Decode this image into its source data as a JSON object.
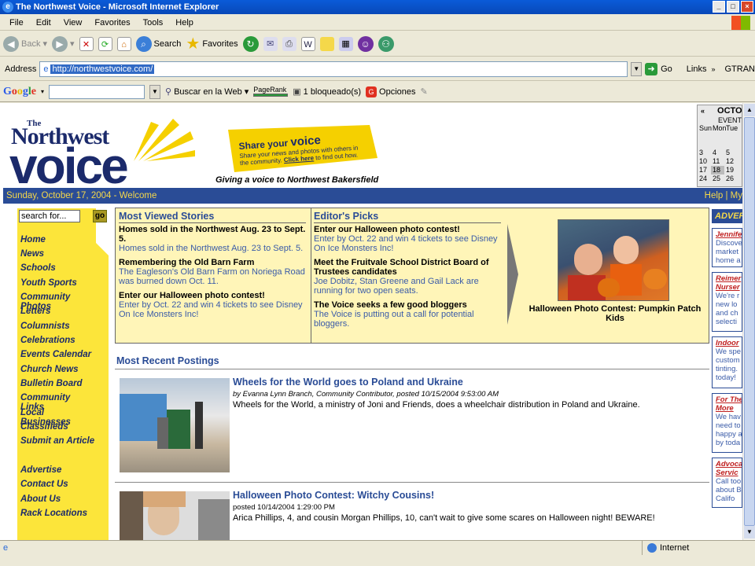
{
  "window": {
    "title": "The Northwest Voice - Microsoft Internet Explorer"
  },
  "menu": [
    "File",
    "Edit",
    "View",
    "Favorites",
    "Tools",
    "Help"
  ],
  "toolbar": {
    "back": "Back",
    "search": "Search",
    "favorites": "Favorites"
  },
  "address": {
    "label": "Address",
    "url": "http://northwestvoice.com/",
    "go": "Go",
    "links": "Links",
    "gtran": "GTRAN"
  },
  "google_bar": {
    "logo": "Google",
    "search_web": "Buscar en la Web",
    "pagerank": "PageRank",
    "blocked": "1 bloqueado(s)",
    "options": "Opciones"
  },
  "header": {
    "logo_the": "The",
    "logo_northwest": "Northwest",
    "logo_voice": "voice",
    "banner_share": "Share your",
    "banner_voice": "voice",
    "banner_line1": "Share your news and photos with others in",
    "banner_line2": "the community.",
    "banner_click": "Click here",
    "banner_line3": "to find out how.",
    "tagline": "Giving a voice to Northwest Bakersfield"
  },
  "calendar": {
    "month": "OCTO",
    "sub": "EVENT",
    "days": [
      "Sun",
      "Mon",
      "Tue"
    ],
    "weeks": [
      [
        "",
        "",
        ""
      ],
      [
        "3",
        "4",
        "5"
      ],
      [
        "10",
        "11",
        "12"
      ],
      [
        "17",
        "18",
        "19"
      ],
      [
        "24",
        "25",
        "26"
      ]
    ]
  },
  "navbar": {
    "date": "Sunday, October 17, 2004",
    "sep": " - ",
    "welcome": "Welcome",
    "right": "Help | My"
  },
  "leftnav": {
    "search_placeholder": "search for...",
    "go": "go",
    "items": [
      "Home",
      "News",
      "Schools",
      "Youth Sports",
      "Community Photos",
      "Letters",
      "Columnists",
      "Celebrations",
      "Events Calendar",
      "Church News",
      "Bulletin Board",
      "Community Links",
      "Local Businesses",
      "Classifieds",
      "Submit an Article"
    ],
    "items2": [
      "Advertise",
      "Contact Us",
      "About Us",
      "Rack Locations"
    ]
  },
  "most_viewed": {
    "heading": "Most Viewed Stories",
    "stories": [
      {
        "title": "Homes sold in the Northwest Aug. 23 to Sept. 5.",
        "desc": "Homes sold in the Northwest Aug. 23 to Sept. 5."
      },
      {
        "title": "Remembering the Old Barn Farm",
        "desc": "The Eagleson's Old Barn Farm on Noriega Road was burned down Oct. 11."
      },
      {
        "title": "Enter our Halloween photo contest!",
        "desc": "Enter by Oct. 22 and win 4 tickets to see Disney On Ice Monsters Inc!"
      }
    ]
  },
  "editors_picks": {
    "heading": "Editor's Picks",
    "stories": [
      {
        "title": "Enter our Halloween photo contest!",
        "desc": "Enter by Oct. 22 and win 4 tickets to see Disney On Ice Monsters Inc!"
      },
      {
        "title": "Meet the Fruitvale School District Board of Trustees candidates",
        "desc": "Joe Dobitz, Stan Greene and Gail Lack are running for two open seats."
      },
      {
        "title": "The Voice seeks a few good bloggers",
        "desc": "The Voice is putting out a call for potential bloggers."
      }
    ]
  },
  "featured_photo": {
    "caption": "Halloween Photo Contest: Pumpkin Patch Kids"
  },
  "recent": {
    "heading": "Most Recent Postings",
    "posts": [
      {
        "title": "Wheels for the World goes to Poland and Ukraine",
        "byline": "by Evanna Lynn Branch, Community Contributor, posted 10/15/2004 9:53:00 AM",
        "desc": "Wheels for the World, a ministry of Joni and Friends, does a wheelchair distribution in Poland and Ukraine."
      },
      {
        "title": "Halloween Photo Contest: Witchy Cousins!",
        "byline": "posted 10/14/2004 1:29:00 PM",
        "desc": "Arica Phillips, 4, and cousin Morgan Phillips, 10, can't wait to give some scares on Halloween night! BEWARE!"
      }
    ]
  },
  "right_col": {
    "heading": "ADVER",
    "boxes": [
      {
        "head": "Jennife",
        "lines": [
          "Discove",
          "market",
          "home a"
        ]
      },
      {
        "head": "Reimer",
        "head2": "Nurser",
        "lines": [
          "We're r",
          "new lo",
          "and ch",
          "selecti"
        ]
      },
      {
        "head": "Indoor",
        "lines": [
          "We spe",
          "custom",
          "tinting.",
          "today!"
        ]
      },
      {
        "head": "For The",
        "head2": "More",
        "lines": [
          "We hav",
          "need to",
          "happy a",
          "by toda"
        ]
      },
      {
        "head": "Advoca",
        "head2": "Servic",
        "lines": [
          "Call too",
          "about B",
          "Califo"
        ]
      }
    ]
  },
  "status": {
    "zone": "Internet"
  },
  "colors": {
    "nav_blue": "#2a4c96",
    "yellow": "#fce53a",
    "pale_yellow": "#fff5b8",
    "logo_navy": "#1b2a6b"
  }
}
